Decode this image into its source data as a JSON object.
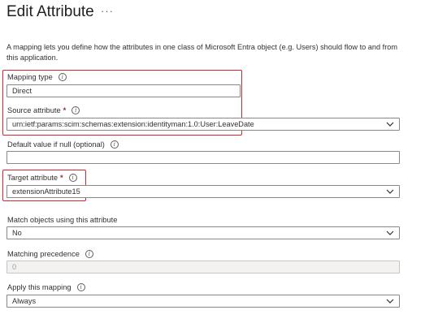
{
  "header": {
    "title": "Edit Attribute",
    "more_label": "···"
  },
  "description": "A mapping lets you define how the attributes in one class of Microsoft Entra object (e.g. Users) should flow to and from this application.",
  "fields": {
    "mapping_type": {
      "label": "Mapping type",
      "value": "Direct"
    },
    "source_attribute": {
      "label": "Source attribute",
      "required_mark": "*",
      "value": "urn:ietf:params:scim:schemas:extension:identityman:1.0:User:LeaveDate"
    },
    "default_value": {
      "label": "Default value if null (optional)",
      "value": ""
    },
    "target_attribute": {
      "label": "Target attribute",
      "required_mark": "*",
      "value": "extensionAttribute15"
    },
    "match_objects": {
      "label": "Match objects using this attribute",
      "value": "No"
    },
    "matching_precedence": {
      "label": "Matching precedence",
      "value": "0"
    },
    "apply_mapping": {
      "label": "Apply this mapping",
      "value": "Always"
    }
  },
  "icons": {
    "info": "info-icon",
    "dropdown": "chevron-down-icon"
  },
  "colors": {
    "highlight": "#e0222a",
    "required": "#a4262c"
  }
}
